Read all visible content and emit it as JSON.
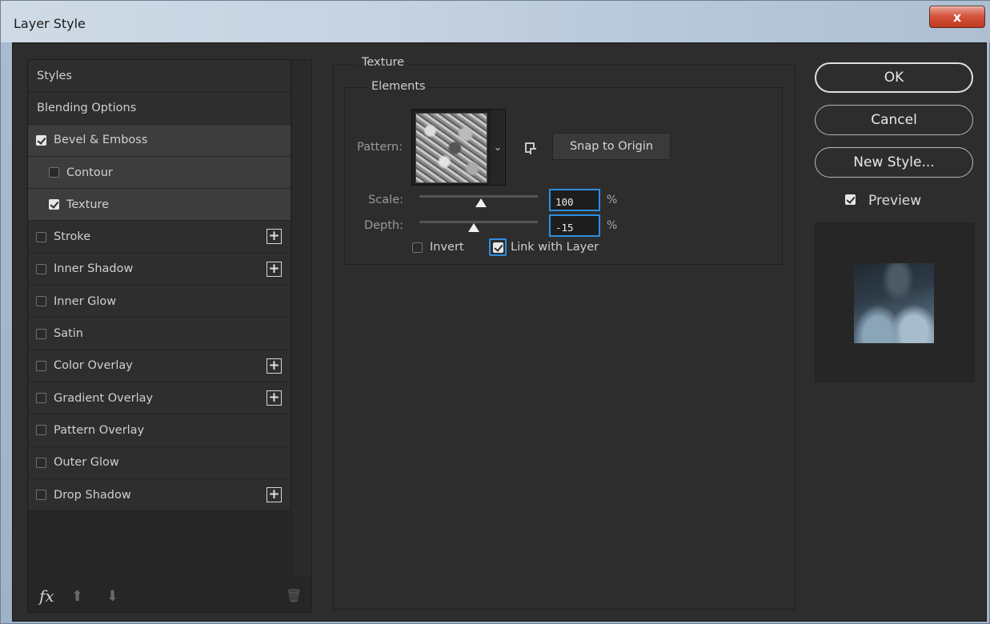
{
  "window": {
    "title": "Layer Style",
    "close_label": "x"
  },
  "sidebar": {
    "items": [
      {
        "label": "Styles",
        "checkbox": null,
        "add": false
      },
      {
        "label": "Blending Options",
        "checkbox": null,
        "add": false
      },
      {
        "label": "Bevel & Emboss",
        "checkbox": true,
        "add": false
      },
      {
        "label": "Contour",
        "checkbox": false,
        "add": false,
        "sub": true
      },
      {
        "label": "Texture",
        "checkbox": true,
        "add": false,
        "sub": true
      },
      {
        "label": "Stroke",
        "checkbox": false,
        "add": true
      },
      {
        "label": "Inner Shadow",
        "checkbox": false,
        "add": true
      },
      {
        "label": "Inner Glow",
        "checkbox": false,
        "add": false
      },
      {
        "label": "Satin",
        "checkbox": false,
        "add": false
      },
      {
        "label": "Color Overlay",
        "checkbox": false,
        "add": true
      },
      {
        "label": "Gradient Overlay",
        "checkbox": false,
        "add": true
      },
      {
        "label": "Pattern Overlay",
        "checkbox": false,
        "add": false
      },
      {
        "label": "Outer Glow",
        "checkbox": false,
        "add": false
      },
      {
        "label": "Drop Shadow",
        "checkbox": false,
        "add": true
      }
    ],
    "plus_glyph": "+",
    "fx_label": "fx",
    "up_arrow": "⬆",
    "down_arrow": "⬇",
    "trash_glyph": "🗑"
  },
  "texture": {
    "group_title": "Texture",
    "elements_title": "Elements",
    "pattern_label": "Pattern:",
    "dropdown_glyph": "⌄",
    "snap_button": "Snap to Origin",
    "scale_label": "Scale:",
    "scale_value": "100",
    "scale_position": 0.52,
    "depth_label": "Depth:",
    "depth_value": "-15",
    "depth_position": 0.46,
    "unit": "%",
    "invert_label": "Invert",
    "invert_checked": false,
    "link_label": "Link with Layer",
    "link_checked": true
  },
  "actions": {
    "ok": "OK",
    "cancel": "Cancel",
    "new_style": "New Style...",
    "preview_label": "Preview",
    "preview_checked": true
  }
}
